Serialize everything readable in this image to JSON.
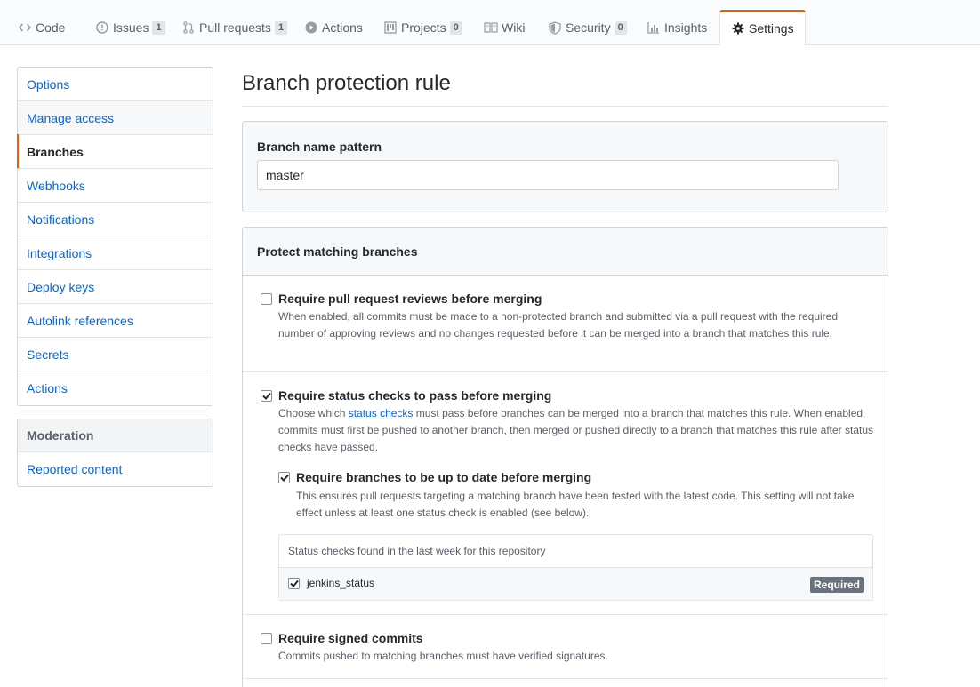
{
  "nav": {
    "tabs": [
      {
        "label": "Code",
        "icon": "code-icon"
      },
      {
        "label": "Issues",
        "icon": "issue-icon",
        "count": "1"
      },
      {
        "label": "Pull requests",
        "icon": "pull-request-icon",
        "count": "1"
      },
      {
        "label": "Actions",
        "icon": "play-icon"
      },
      {
        "label": "Projects",
        "icon": "project-icon",
        "count": "0"
      },
      {
        "label": "Wiki",
        "icon": "book-icon"
      },
      {
        "label": "Security",
        "icon": "shield-icon",
        "count": "0"
      },
      {
        "label": "Insights",
        "icon": "graph-icon"
      },
      {
        "label": "Settings",
        "icon": "gear-icon"
      }
    ],
    "selected": "Settings",
    "accent_color": "#e36209"
  },
  "sidebar": {
    "items": [
      "Options",
      "Manage access",
      "Branches",
      "Webhooks",
      "Notifications",
      "Integrations",
      "Deploy keys",
      "Autolink references",
      "Secrets",
      "Actions"
    ],
    "selected": "Branches",
    "moderation_heading": "Moderation",
    "moderation_items": [
      "Reported content"
    ]
  },
  "main": {
    "title": "Branch protection rule",
    "pattern_label": "Branch name pattern",
    "pattern_value": "master",
    "protect_heading": "Protect matching branches",
    "options": {
      "reviews": {
        "title": "Require pull request reviews before merging",
        "checked": false,
        "desc": "When enabled, all commits must be made to a non-protected branch and submitted via a pull request with the required number of approving reviews and no changes requested before it can be merged into a branch that matches this rule."
      },
      "status_checks": {
        "title": "Require status checks to pass before merging",
        "checked": true,
        "desc_pre": "Choose which ",
        "desc_link": "status checks",
        "desc_post": " must pass before branches can be merged into a branch that matches this rule. When enabled, commits must first be pushed to another branch, then merged or pushed directly to a branch that matches this rule after status checks have passed."
      },
      "up_to_date": {
        "title": "Require branches to be up to date before merging",
        "checked": true,
        "desc": "This ensures pull requests targeting a matching branch have been tested with the latest code. This setting will not take effect unless at least one status check is enabled (see below)."
      },
      "signed": {
        "title": "Require signed commits",
        "checked": false,
        "desc": "Commits pushed to matching branches must have verified signatures."
      }
    },
    "checks_heading": "Status checks found in the last week for this repository",
    "checks": [
      {
        "name": "jenkins_status",
        "checked": true,
        "badge": "Required"
      }
    ]
  }
}
